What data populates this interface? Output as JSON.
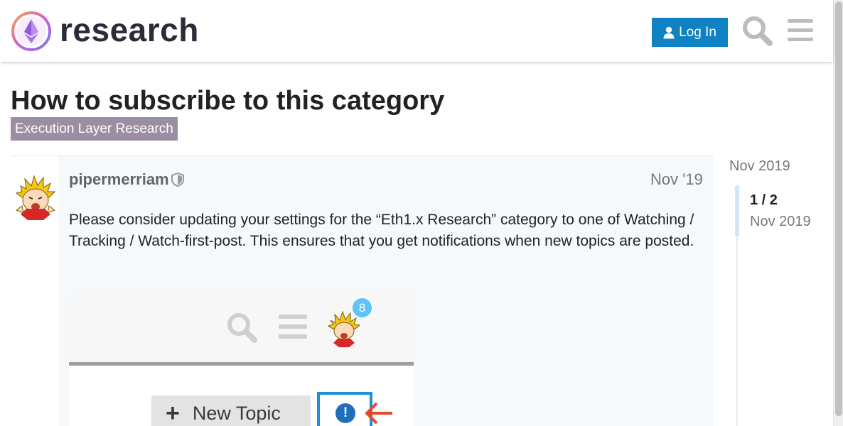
{
  "header": {
    "brand": "research",
    "login_label": "Log In",
    "icons": {
      "logo": "ethereum-research-logo",
      "login": "user-icon",
      "search": "search-icon",
      "menu": "hamburger-menu-icon"
    }
  },
  "topic": {
    "title": "How to subscribe to this category",
    "category": "Execution Layer Research",
    "category_color": "#9b8ea3"
  },
  "post": {
    "username": "pipermerriam",
    "date": "Nov '19",
    "body": "Please consider updating your settings for the “Eth1.x Research” category to one of Watching / Tracking / Watch-first-post. This ensures that you get notifications when new topics are posted.",
    "image": {
      "notification_count": "8",
      "new_topic_label": "New Topic",
      "notification_symbol": "!"
    }
  },
  "timeline": {
    "start_date": "Nov 2019",
    "position": "1 / 2",
    "current_date": "Nov 2019"
  },
  "colors": {
    "accent": "#0e82c2",
    "post_background": "#f6f9fc"
  }
}
